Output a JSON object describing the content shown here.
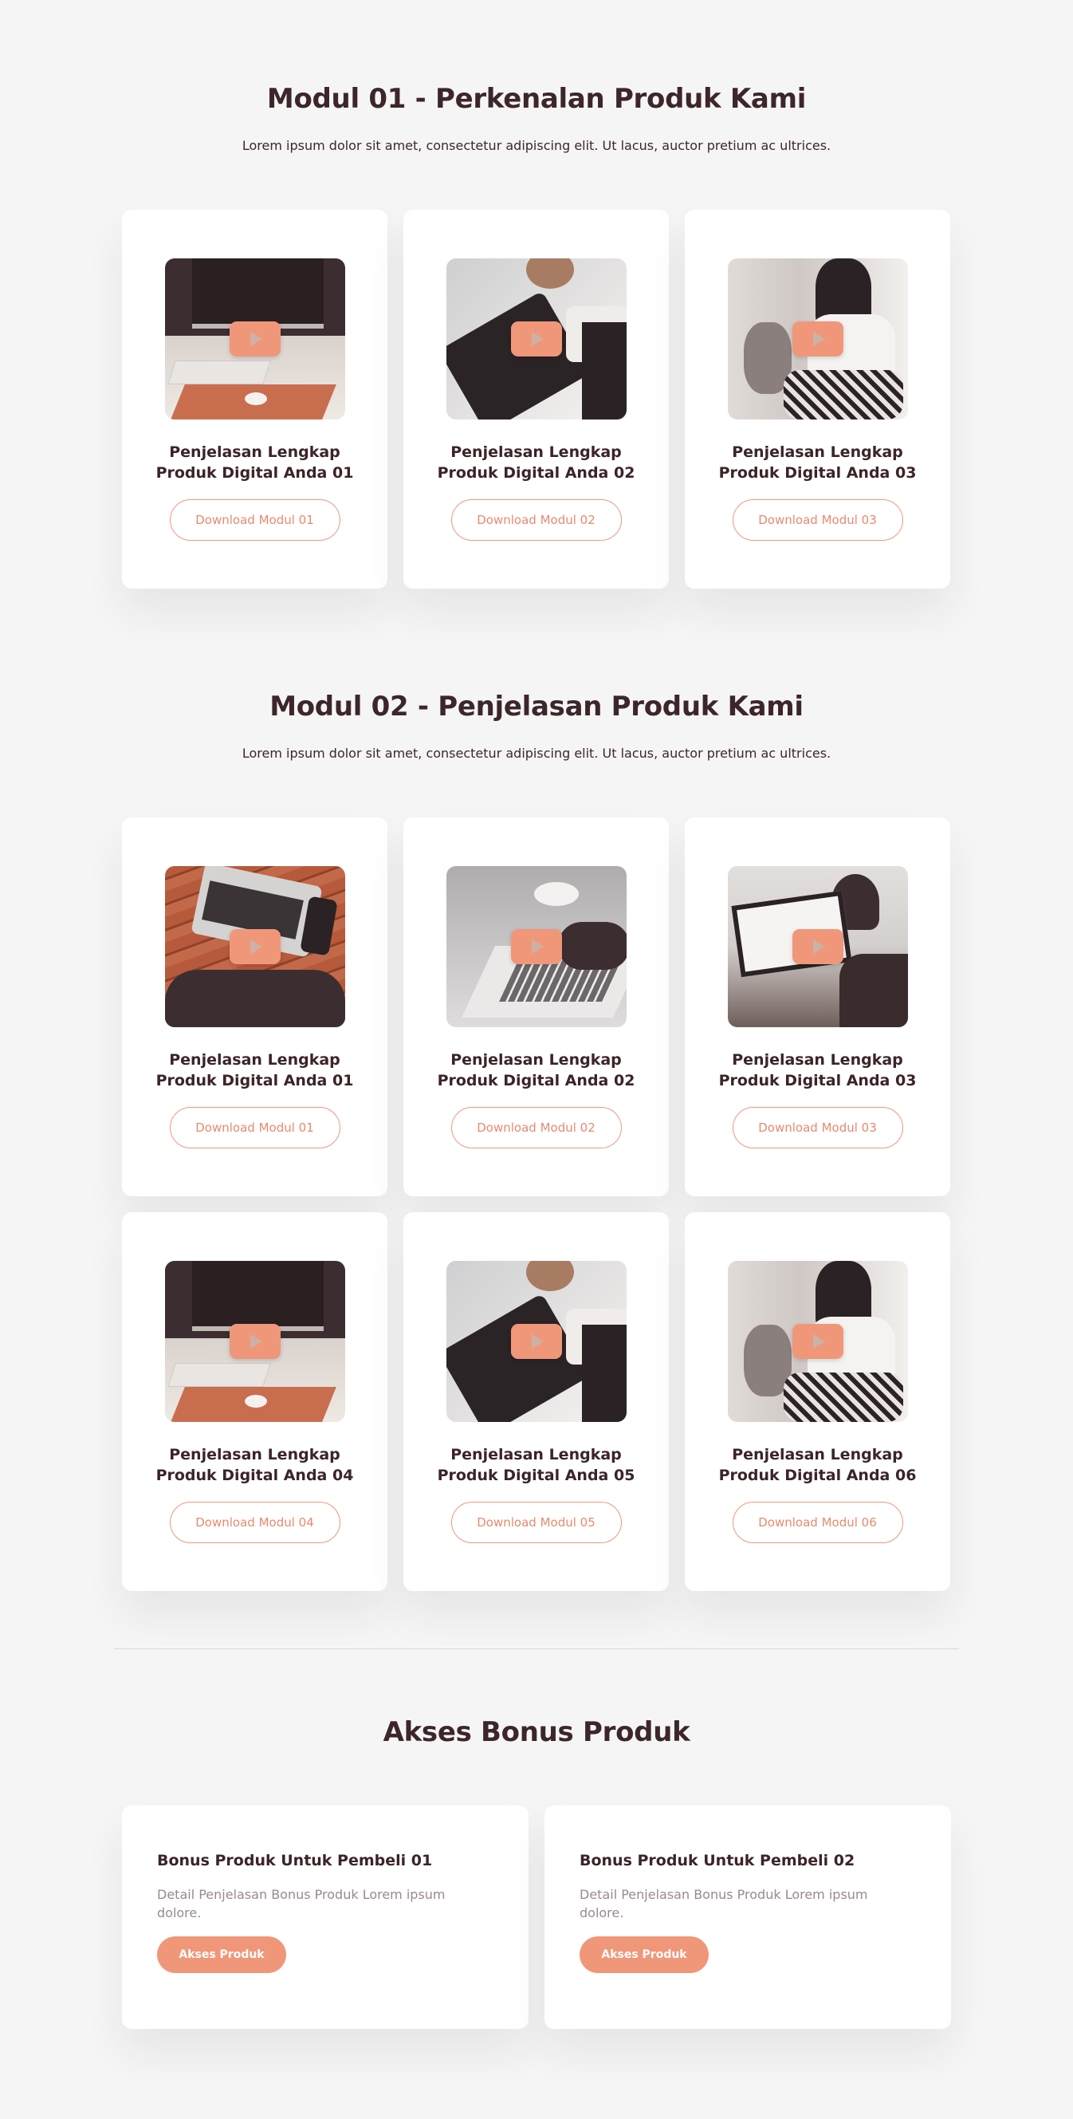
{
  "modul1": {
    "title": "Modul 01 - Perkenalan Produk Kami",
    "subtitle": "Lorem ipsum dolor sit amet, consectetur adipiscing elit. Ut lacus, auctor pretium ac ultrices.",
    "cards": [
      {
        "title_line1": "Penjelasan Lengkap",
        "title_line2": "Produk Digital Anda 01",
        "button": "Download Modul 01"
      },
      {
        "title_line1": "Penjelasan Lengkap",
        "title_line2": "Produk Digital Anda 02",
        "button": "Download Modul 02"
      },
      {
        "title_line1": "Penjelasan Lengkap",
        "title_line2": "Produk Digital Anda 03",
        "button": "Download Modul 03"
      }
    ]
  },
  "modul2": {
    "title": "Modul 02 - Penjelasan Produk Kami",
    "subtitle": "Lorem ipsum dolor sit amet, consectetur adipiscing elit. Ut lacus, auctor pretium ac ultrices.",
    "cards": [
      {
        "title_line1": "Penjelasan Lengkap",
        "title_line2": "Produk Digital Anda 01",
        "button": "Download Modul 01"
      },
      {
        "title_line1": "Penjelasan Lengkap",
        "title_line2": "Produk Digital Anda 02",
        "button": "Download Modul 02"
      },
      {
        "title_line1": "Penjelasan Lengkap",
        "title_line2": "Produk Digital Anda 03",
        "button": "Download Modul 03"
      },
      {
        "title_line1": "Penjelasan Lengkap",
        "title_line2": "Produk Digital Anda 04",
        "button": "Download Modul 04"
      },
      {
        "title_line1": "Penjelasan Lengkap",
        "title_line2": "Produk Digital Anda 05",
        "button": "Download Modul 05"
      },
      {
        "title_line1": "Penjelasan Lengkap",
        "title_line2": "Produk Digital Anda 06",
        "button": "Download Modul 06"
      }
    ]
  },
  "bonus": {
    "title": "Akses Bonus Produk",
    "cards": [
      {
        "title": "Bonus Produk Untuk Pembeli 01",
        "desc": "Detail Penjelasan Bonus Produk Lorem ipsum dolore.",
        "button": "Akses Produk"
      },
      {
        "title": "Bonus Produk Untuk Pembeli 02",
        "desc": "Detail Penjelasan Bonus Produk Lorem ipsum dolore.",
        "button": "Akses Produk"
      }
    ]
  },
  "colors": {
    "accent": "#f0977a",
    "heading": "#3d2629",
    "background": "#f5f5f6"
  },
  "icons": {
    "video_play": "play-icon"
  }
}
